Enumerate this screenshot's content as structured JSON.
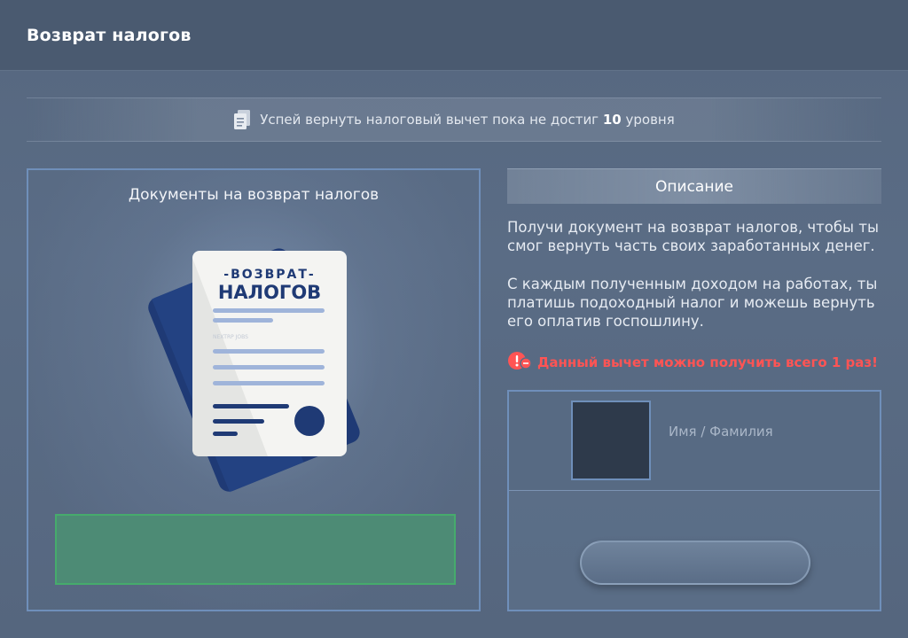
{
  "header": {
    "title": "Возврат налогов"
  },
  "banner": {
    "text_before": "Успей вернуть налоговый вычет пока не достиг",
    "level": "10",
    "text_after": "уровня",
    "icon": "document-icon"
  },
  "left_panel": {
    "title": "Документы на возврат налогов",
    "document": {
      "title_top": "-ВОЗВРАТ-",
      "title_main": "НАЛОГОВ",
      "brand": "NEXTRP JOBS"
    },
    "button_label": ""
  },
  "description": {
    "header": "Описание",
    "paragraph1": "Получи документ на возврат налогов, чтобы ты смог вернуть часть своих заработанных денег.",
    "paragraph2": "С каждым полученным доходом на работах, ты платишь подоходный налог и можешь вернуть его оплатив госпошлину.",
    "warning": "Данный вычет можно получить всего 1 раз!",
    "warning_color": "#ff5454"
  },
  "card": {
    "name_placeholder": "Имя / Фамилия",
    "button_label": ""
  },
  "colors": {
    "accent_border": "#6f8fba",
    "button_green": "#4d8b75",
    "document_navy": "#1f3a75"
  }
}
